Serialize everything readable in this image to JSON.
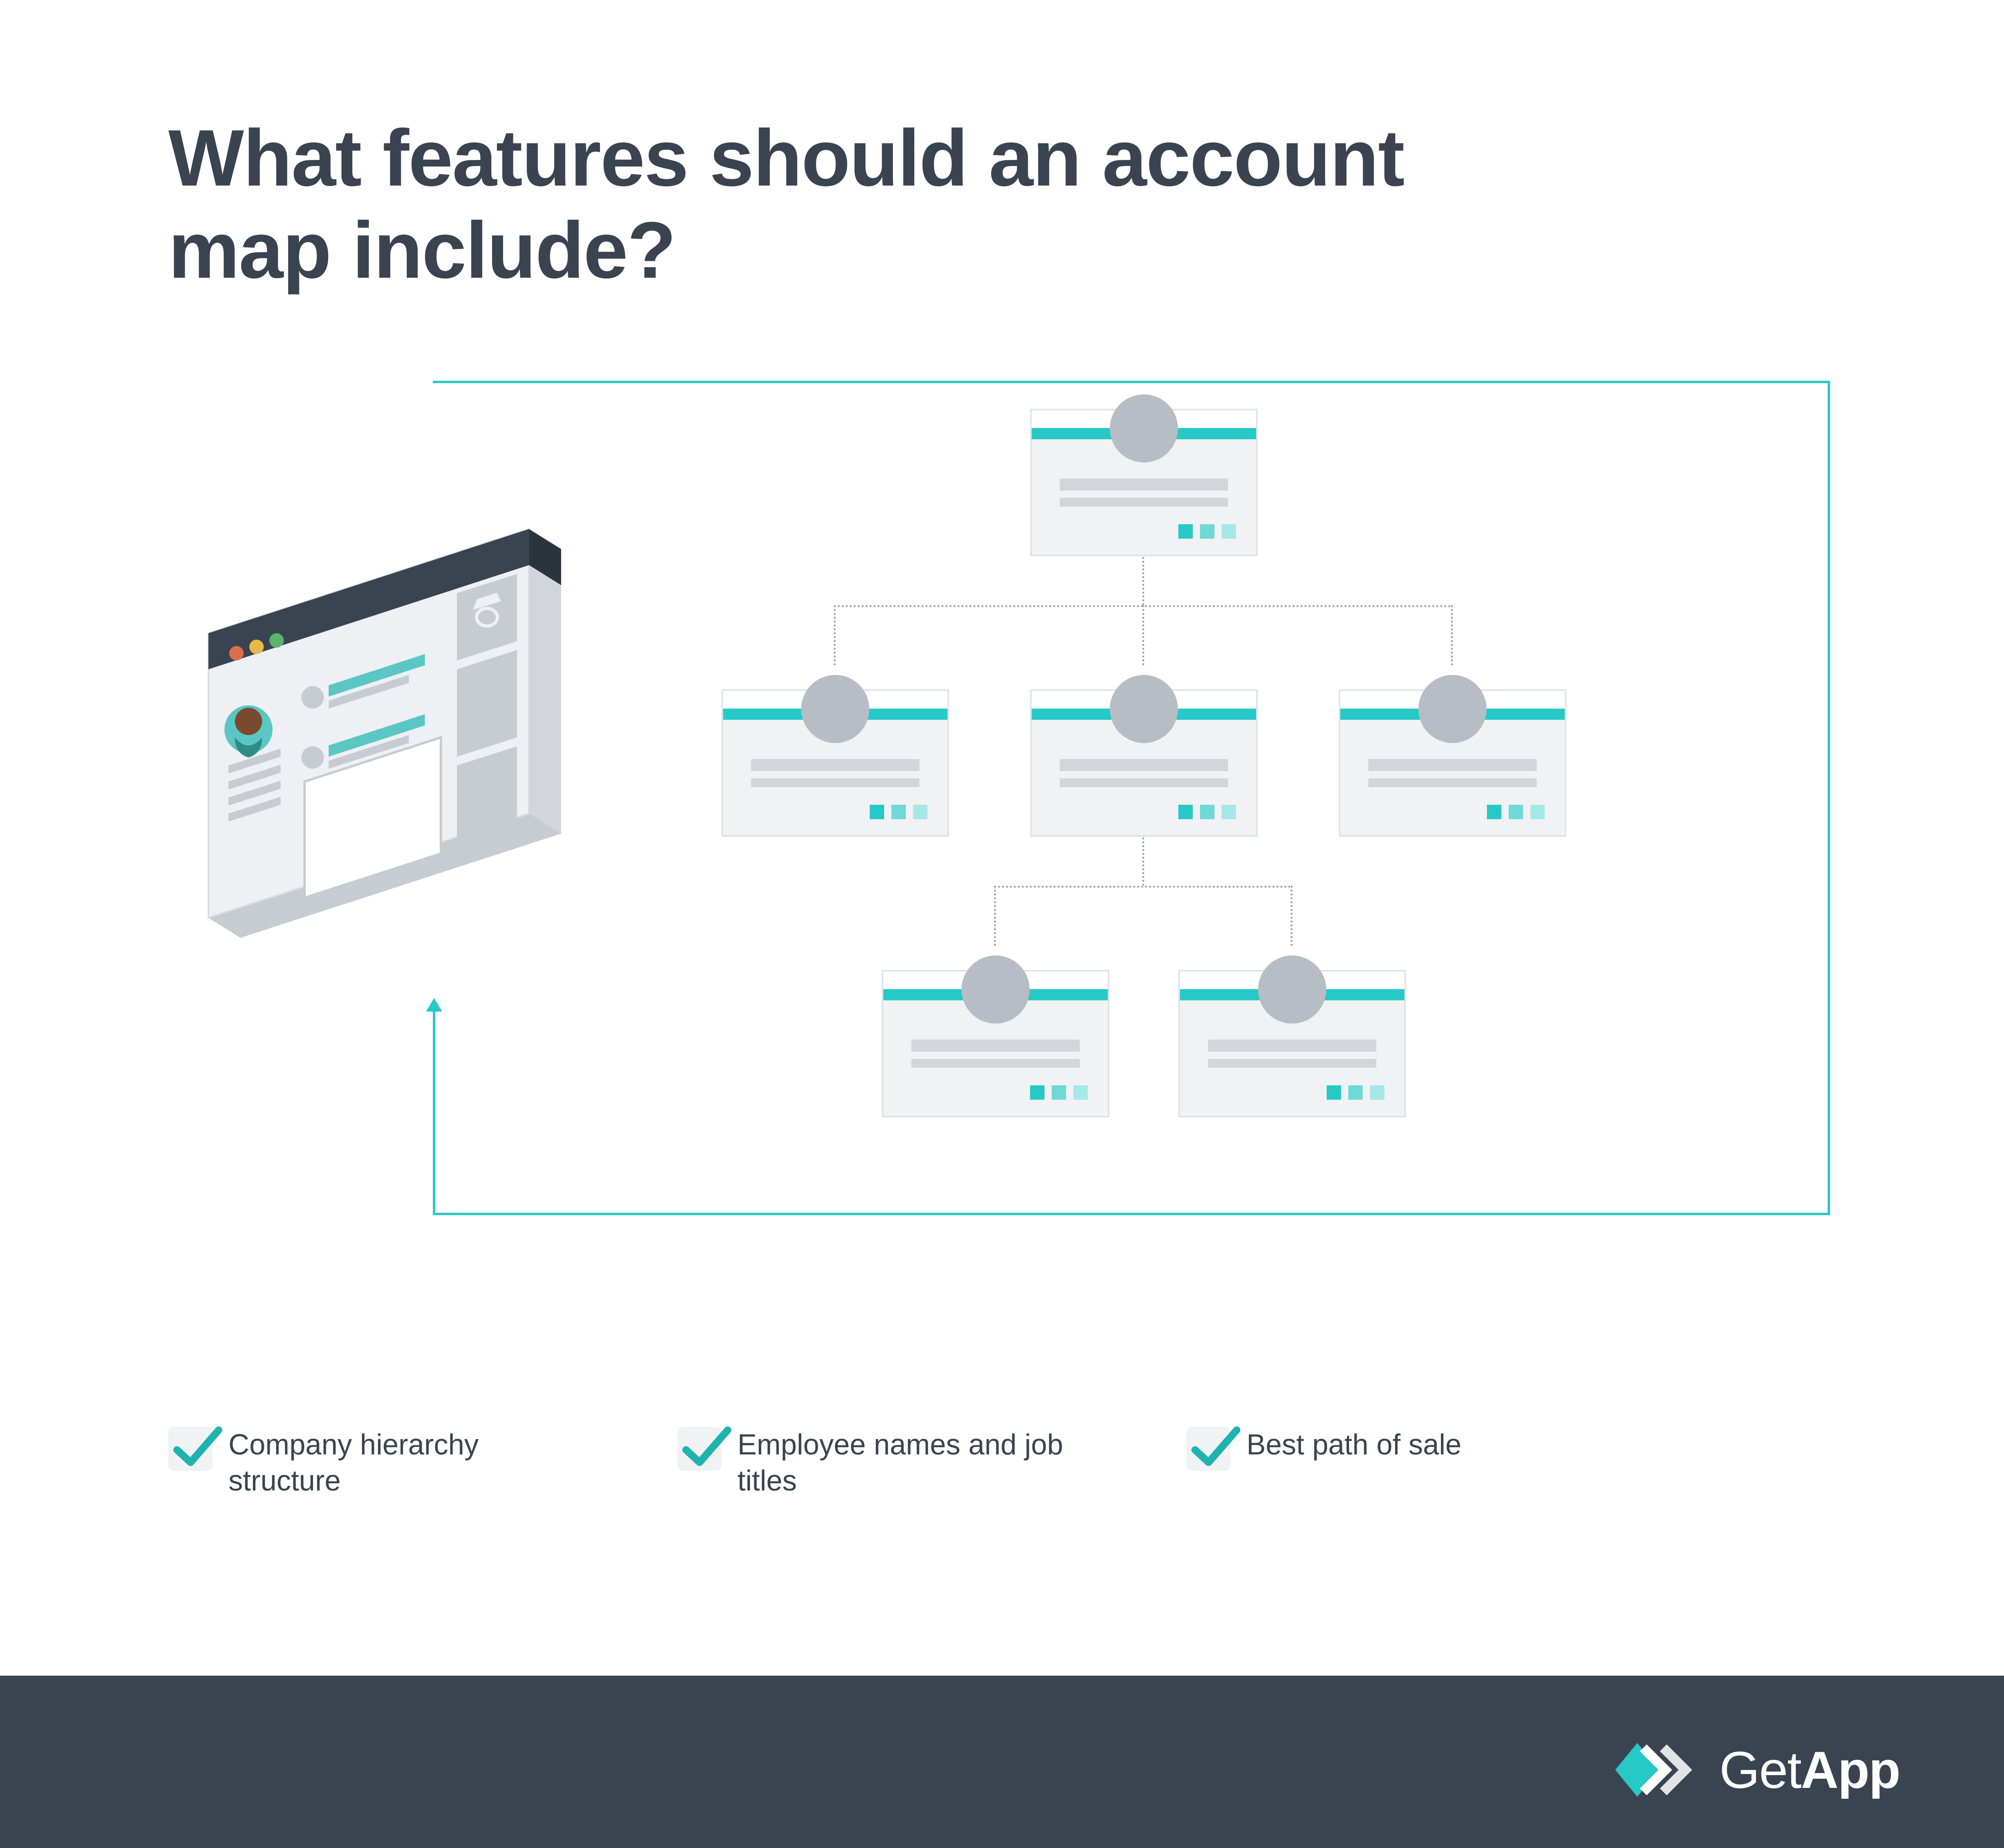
{
  "title": "What features should an account map include?",
  "checklist": {
    "items": [
      {
        "label": "Company hierarchy structure"
      },
      {
        "label": "Employee names and job titles"
      },
      {
        "label": "Best path of sale"
      }
    ]
  },
  "brand": {
    "part1": "Get",
    "part2": "App"
  },
  "colors": {
    "accent": "#27c9c6",
    "dark": "#3a4450"
  }
}
